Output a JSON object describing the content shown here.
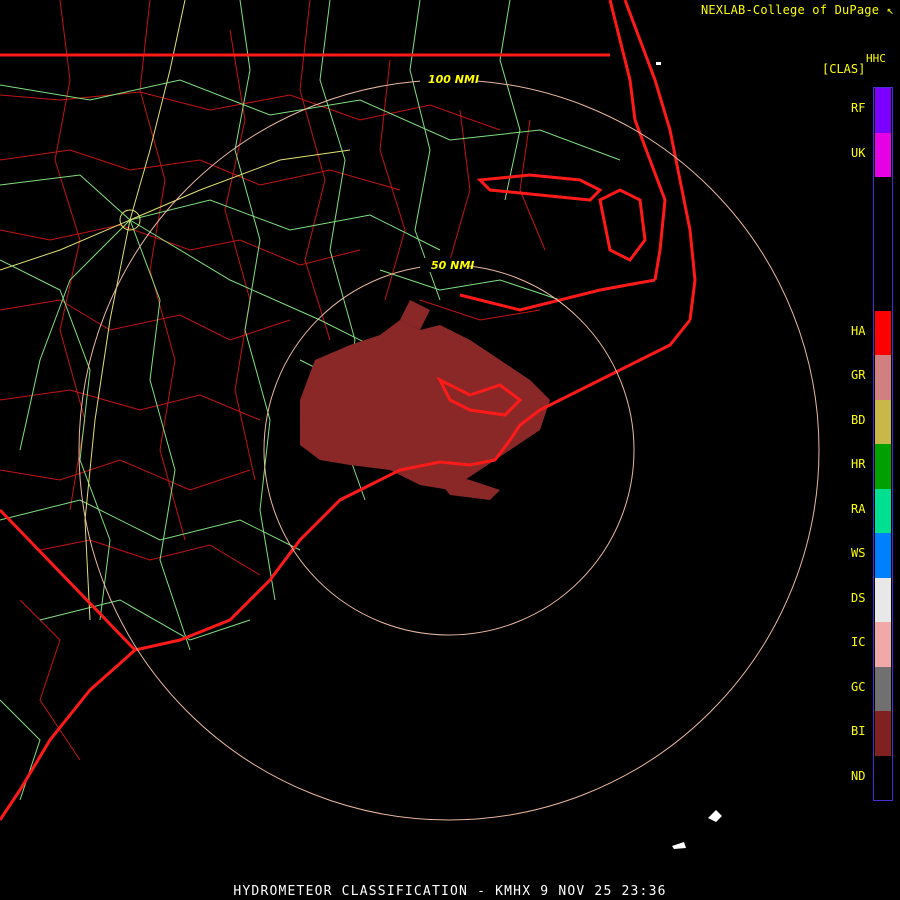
{
  "credit": "NEXLAB-College of DuPage",
  "caption": "HYDROMETEOR CLASSIFICATION - KMHX 9 NOV 25 23:36",
  "range_rings": [
    "50 NMI",
    "100 NMI"
  ],
  "legend": {
    "product": "HHC",
    "unit": "[CLAS]",
    "classes": [
      {
        "code": "RF",
        "color": "#7a00ff"
      },
      {
        "code": "UK",
        "color": "#e600e6"
      },
      {
        "code": "",
        "color": "#000000"
      },
      {
        "code": "",
        "color": "#000000"
      },
      {
        "code": "",
        "color": "#000000"
      },
      {
        "code": "HA",
        "color": "#ff0000"
      },
      {
        "code": "GR",
        "color": "#d08080"
      },
      {
        "code": "BD",
        "color": "#c8b84a"
      },
      {
        "code": "HR",
        "color": "#00a000"
      },
      {
        "code": "RA",
        "color": "#00e090"
      },
      {
        "code": "WS",
        "color": "#0080ff"
      },
      {
        "code": "DS",
        "color": "#e8e8e8"
      },
      {
        "code": "IC",
        "color": "#f0a8a8"
      },
      {
        "code": "GC",
        "color": "#707070"
      },
      {
        "code": "BI",
        "color": "#802020"
      },
      {
        "code": "ND",
        "color": "#000000"
      }
    ]
  },
  "colors": {
    "land_outline": "#ff1a1a",
    "county_lines": "#c01010",
    "roads": "#7fe07f",
    "highways": "#e0e070",
    "range_ring": "#e8b8a0",
    "echo_bi": "#8a2828"
  }
}
